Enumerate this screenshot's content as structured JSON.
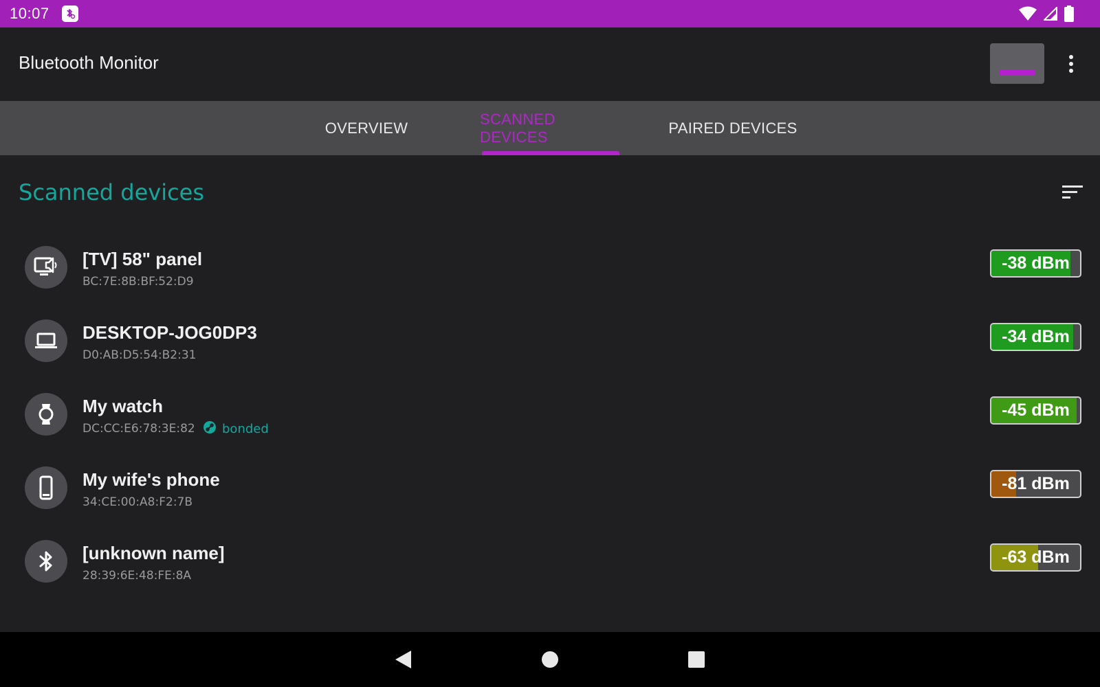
{
  "status_bar": {
    "time": "10:07",
    "notification_icon": "bluetooth-scan-icon",
    "icons": [
      "wifi-icon",
      "cellular-signal-icon",
      "battery-icon"
    ],
    "background_color": "#a020b8"
  },
  "app_bar": {
    "title": "Bluetooth Monitor",
    "action_button_icon": "scan-toggle-icon",
    "overflow_icon": "more-vert-icon"
  },
  "tabs": [
    {
      "label": "OVERVIEW",
      "active": false
    },
    {
      "label": "SCANNED DEVICES",
      "active": true
    },
    {
      "label": "PAIRED DEVICES",
      "active": false
    }
  ],
  "section": {
    "heading": "Scanned devices",
    "sort_icon": "sort-icon",
    "heading_color": "#14a79c"
  },
  "devices": [
    {
      "name": "[TV] 58\" panel",
      "mac": "BC:7E:8B:BF:52:D9",
      "icon": "tv-speaker-icon",
      "rssi": "-38 dBm",
      "signal_level": 0.89,
      "signal_color": "#1f9b1f",
      "bonded": false
    },
    {
      "name": "DESKTOP-JOG0DP3",
      "mac": "D0:AB:D5:54:B2:31",
      "icon": "laptop-icon",
      "rssi": "-34 dBm",
      "signal_level": 0.92,
      "signal_color": "#1f9b1f",
      "bonded": false
    },
    {
      "name": "My watch",
      "mac": "DC:CC:E6:78:3E:82",
      "icon": "watch-icon",
      "rssi": "-45 dBm",
      "signal_level": 0.96,
      "signal_color": "#3f9a15",
      "bonded": true,
      "bonded_label": "bonded",
      "bonded_icon": "link-icon"
    },
    {
      "name": "My wife's phone",
      "mac": "34:CE:00:A8:F2:7B",
      "icon": "smartphone-icon",
      "rssi": "-81 dBm",
      "signal_level": 0.28,
      "signal_color": "#a0580e",
      "bonded": false
    },
    {
      "name": "[unknown name]",
      "mac": "28:39:6E:48:FE:8A",
      "icon": "bluetooth-icon",
      "rssi": "-63 dBm",
      "signal_level": 0.53,
      "signal_color": "#8e9410",
      "bonded": false
    }
  ],
  "nav_bar": {
    "back_icon": "back-triangle-icon",
    "home_icon": "home-circle-icon",
    "recents_icon": "recents-square-icon"
  }
}
